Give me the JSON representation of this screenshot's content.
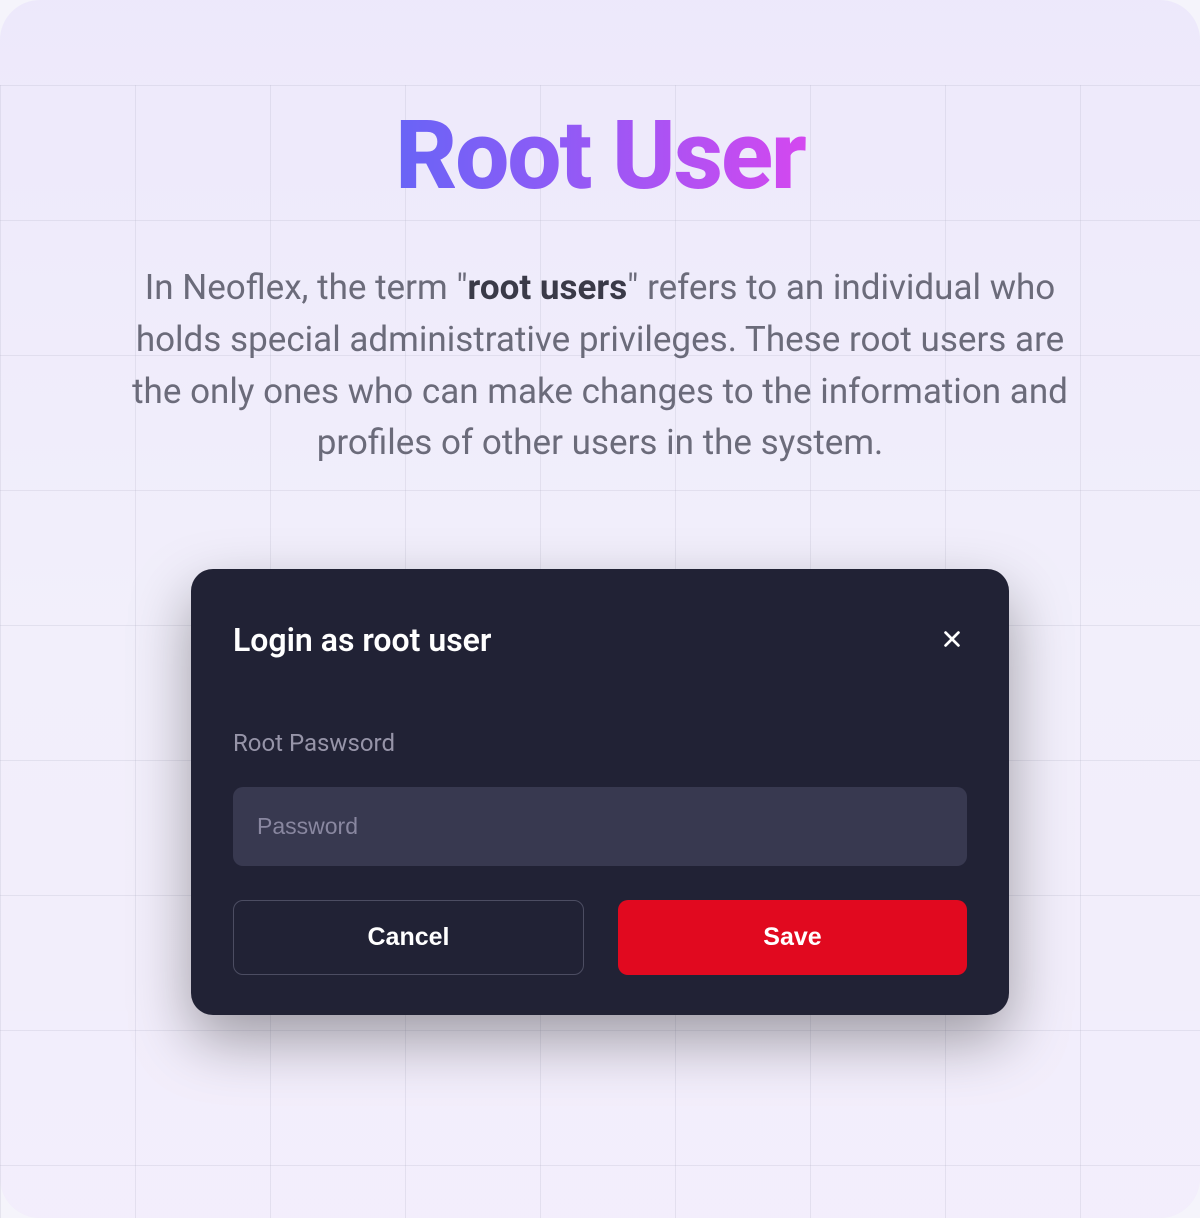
{
  "page": {
    "title": "Root User",
    "description_prefix": "In Neoflex, the term \"",
    "description_bold": "root users",
    "description_suffix": "\" refers to an individual who holds special administrative privileges. These root users are the only ones who can make changes to the information and profiles of other users in the system."
  },
  "modal": {
    "title": "Login as root user",
    "field_label": "Root Paswsord",
    "password_placeholder": "Password",
    "cancel_label": "Cancel",
    "save_label": "Save"
  }
}
